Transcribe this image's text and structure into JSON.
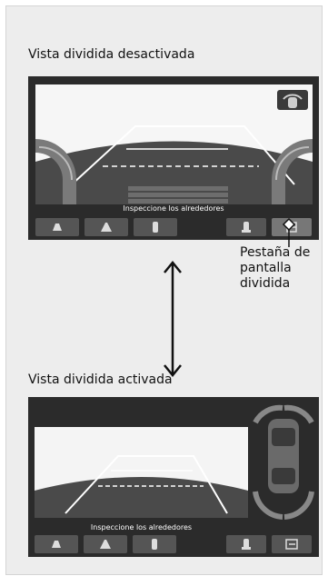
{
  "top_view": {
    "title": "Vista dividida desactivada",
    "caption": "Inspeccione los alrededores",
    "buttons": [
      "view-icon",
      "wide-view-icon",
      "top-down-icon",
      "rear-icon",
      "split-screen-icon"
    ]
  },
  "callout": {
    "line1": "Pestaña de",
    "line2": "pantalla",
    "line3": "dividida"
  },
  "bottom_view": {
    "title": "Vista dividida activada",
    "caption": "Inspeccione los alrededores"
  },
  "colors": {
    "page_bg": "#ededed",
    "panel_bg": "#2b2b2b",
    "screen_bg": "#f4f4f4",
    "button_bg": "#555555",
    "guideline": "#ffffff"
  }
}
